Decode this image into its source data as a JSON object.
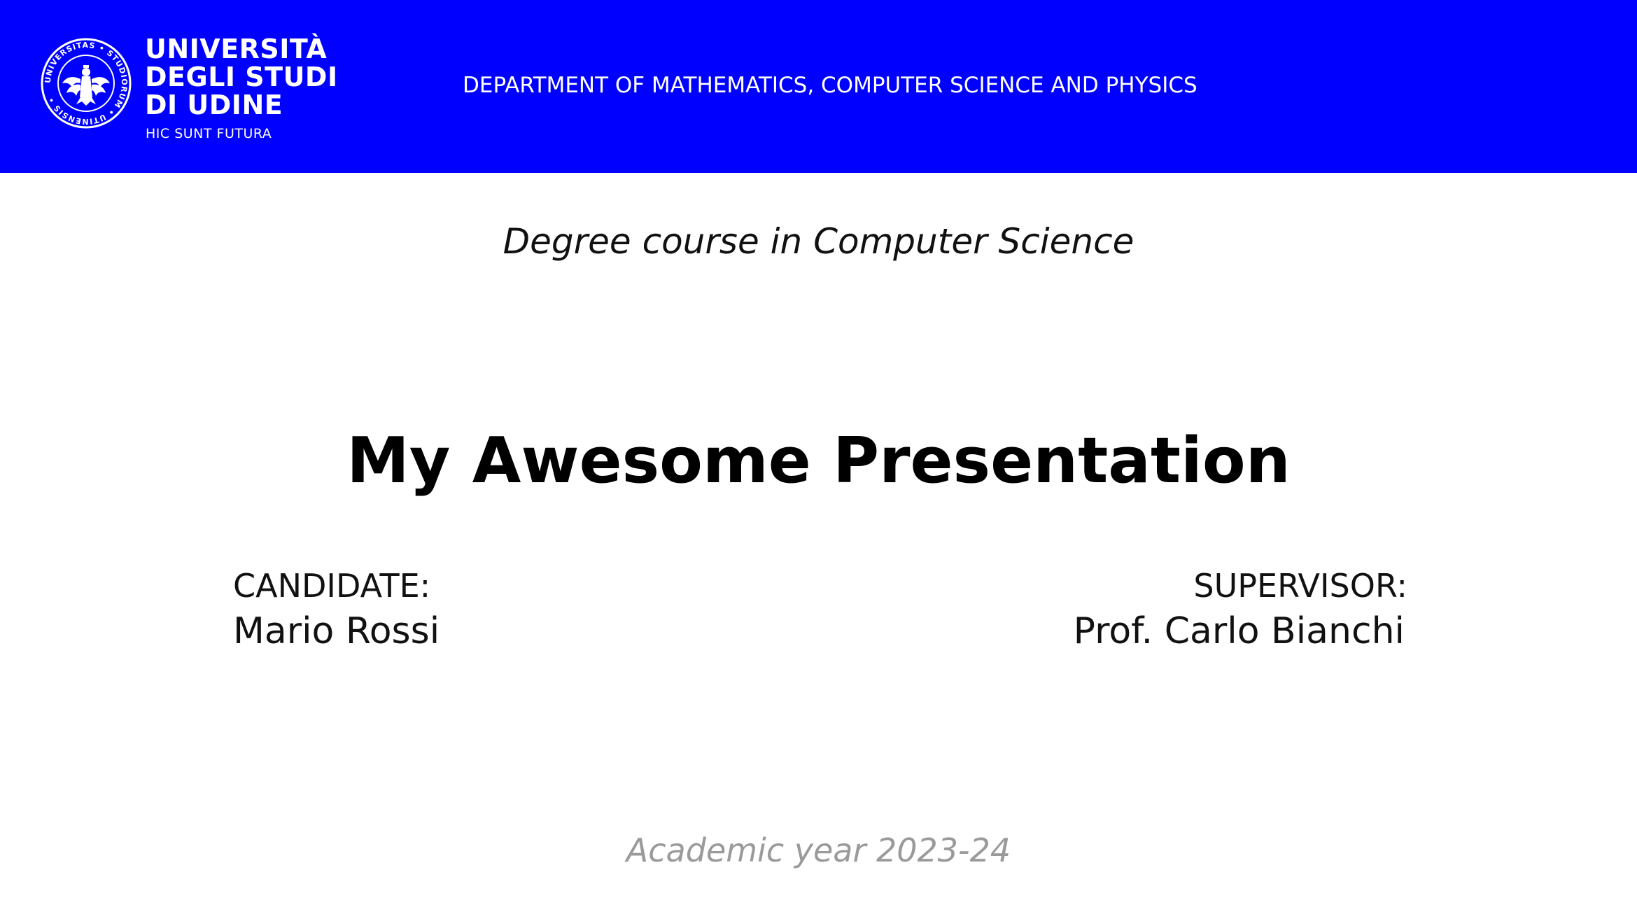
{
  "header": {
    "university_lines": [
      "UNIVERSITÀ",
      "DEGLI STUDI",
      "DI UDINE"
    ],
    "motto": "HIC SUNT FUTURA",
    "department": "DEPARTMENT OF MATHEMATICS, COMPUTER SCIENCE AND PHYSICS",
    "seal_text": "UNIVERSITAS • STUDIORUM • UTINENSIS •",
    "bg_color": "#0000ff"
  },
  "course": "Degree course in Computer Science",
  "title": "My Awesome Presentation",
  "candidate": {
    "label": "CANDIDATE:",
    "name": "Mario Rossi"
  },
  "supervisor": {
    "label": "SUPERVISOR:",
    "name": "Prof. Carlo Bianchi"
  },
  "academic_year": "Academic year 2023-24"
}
